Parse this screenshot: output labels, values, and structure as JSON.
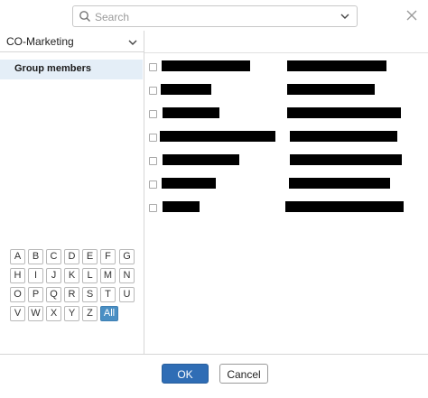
{
  "search": {
    "placeholder": "Search",
    "value": ""
  },
  "group_selector": {
    "selected": "CO-Marketing"
  },
  "sidebar": {
    "items": [
      {
        "label": "Group members",
        "selected": true
      }
    ]
  },
  "alphabet": {
    "keys": [
      "A",
      "B",
      "C",
      "D",
      "E",
      "F",
      "G",
      "H",
      "I",
      "J",
      "K",
      "L",
      "M",
      "N",
      "O",
      "P",
      "Q",
      "R",
      "S",
      "T",
      "U",
      "V",
      "W",
      "X",
      "Y",
      "Z",
      "All"
    ],
    "active": "All"
  },
  "members": {
    "rows": [
      {
        "checked": false,
        "name": "",
        "email": "",
        "redacted": true
      },
      {
        "checked": false,
        "name": "",
        "email": "",
        "redacted": true
      },
      {
        "checked": false,
        "name": "",
        "email": "",
        "redacted": true
      },
      {
        "checked": false,
        "name": "",
        "email": "",
        "redacted": true
      },
      {
        "checked": false,
        "name": "",
        "email": "",
        "redacted": true
      },
      {
        "checked": false,
        "name": "",
        "email": "",
        "redacted": true
      },
      {
        "checked": false,
        "name": "",
        "email": "",
        "redacted": true
      }
    ]
  },
  "footer": {
    "ok_label": "OK",
    "cancel_label": "Cancel"
  },
  "colors": {
    "accent": "#2f6db5",
    "selection": "#e4eef7",
    "active_key": "#4a8fc4",
    "border": "#d6d6d6"
  },
  "icons": {
    "search": "search-icon",
    "dropdown": "chevron-down-icon",
    "close": "close-icon"
  }
}
